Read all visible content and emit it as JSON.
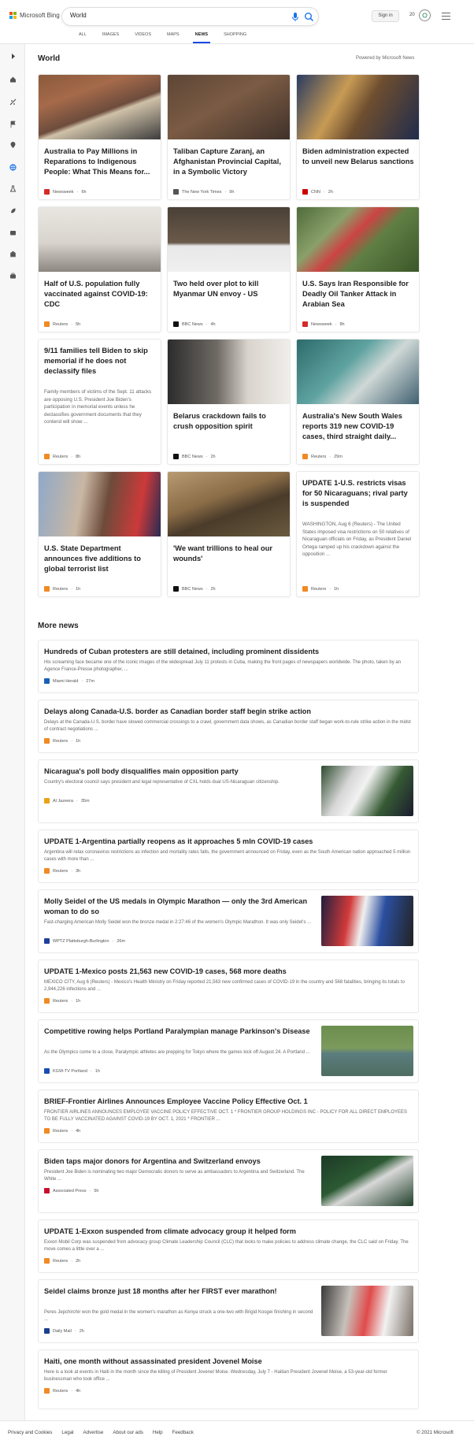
{
  "brand": {
    "name": "Microsoft Bing"
  },
  "search": {
    "query": "World"
  },
  "header": {
    "signin": "Sign in",
    "rewards_count": "20"
  },
  "scopes": [
    "ALL",
    "IMAGES",
    "VIDEOS",
    "MAPS",
    "NEWS",
    "SHOPPING"
  ],
  "active_scope": "NEWS",
  "rail_icons": [
    "expand-icon",
    "home-icon",
    "sports-icon",
    "flag-icon",
    "location-pin-icon",
    "globe-icon",
    "science-icon",
    "rocket-icon",
    "entertainment-icon",
    "politics-icon",
    "business-icon"
  ],
  "section": {
    "title": "World",
    "powered_by": "Powered by Microsoft News"
  },
  "cards": [
    {
      "title": "Australia to Pay Millions in Reparations to Indigenous People: What This Means for...",
      "source": "Newsweek",
      "time": "6h",
      "logo_color": "#d42b2b"
    },
    {
      "title": "Taliban Capture Zaranj, an Afghanistan Provincial Capital, in a Symbolic Victory",
      "source": "The New York Times",
      "time": "9h",
      "logo_color": "#555555"
    },
    {
      "title": "Biden administration expected to unveil new Belarus sanctions",
      "source": "CNN",
      "time": "2h",
      "logo_color": "#cc0000"
    },
    {
      "title": "Half of U.S. population fully vaccinated against COVID-19: CDC",
      "source": "Reuters",
      "time": "5h",
      "logo_color": "#f08a24"
    },
    {
      "title": "Two held over plot to kill Myanmar UN envoy - US",
      "source": "BBC News",
      "time": "4h",
      "logo_color": "#111111"
    },
    {
      "title": "U.S. Says Iran Responsible for Deadly Oil Tanker Attack in Arabian Sea",
      "source": "Newsweek",
      "time": "8h",
      "logo_color": "#d42b2b"
    },
    {
      "title": "9/11 families tell Biden to skip memorial if he does not declassify files",
      "snippet": "Family members of victims of the Sept. 11 attacks are opposing U.S. President Joe Biden's participation in memorial events unless he declassifies government documents that they contend will show ...",
      "source": "Reuters",
      "time": "8h",
      "logo_color": "#f08a24"
    },
    {
      "title": "Belarus crackdown fails to crush opposition spirit",
      "source": "BBC News",
      "time": "2h",
      "logo_color": "#111111"
    },
    {
      "title": "Australia's New South Wales reports 319 new COVID-19 cases, third straight daily...",
      "source": "Reuters",
      "time": "29m",
      "logo_color": "#f08a24"
    },
    {
      "title": "U.S. State Department announces five additions to global terrorist list",
      "source": "Reuters",
      "time": "1h",
      "logo_color": "#f08a24"
    },
    {
      "title": "'We want trillions to heal our wounds'",
      "source": "BBC News",
      "time": "2h",
      "logo_color": "#111111"
    },
    {
      "title": "UPDATE 1-U.S. restricts visas for 50 Nicaraguans; rival party is suspended",
      "snippet": "WASHINGTON, Aug 6 (Reuters) - The United States imposed visa restrictions on 50 relatives of Nicaraguan officials on Friday, as President Daniel Ortega ramped up his crackdown against the opposition ...",
      "source": "Reuters",
      "time": "1h",
      "logo_color": "#f08a24"
    }
  ],
  "more_news": {
    "title": "More news",
    "items": [
      {
        "title": "Hundreds of Cuban protesters are still detained, including prominent dissidents",
        "snippet": "His screaming face became one of the iconic images of the widespread July 11 protests in Cuba, making the front pages of newspapers worldwide. The photo, taken by an Agence France-Presse photographer, ...",
        "source": "Miami Herald",
        "time": "27m",
        "logo_color": "#1a5fb4"
      },
      {
        "title": "Delays along Canada-U.S. border as Canadian border staff begin strike action",
        "snippet": "Delays at the Canada-U.S. border have slowed commercial crossings to a crawl, government data shows, as Canadian border staff began work-to-rule strike action in the midst of contract negotiations ...",
        "source": "Reuters",
        "time": "1h",
        "logo_color": "#f08a24"
      },
      {
        "title": "Nicaragua's poll body disqualifies main opposition party",
        "snippet": "Country's electoral council says president and legal representative of CXL holds dual US-Nicaraguan citizenship.",
        "source": "Al Jazeera",
        "time": "35m",
        "logo_color": "#e8a317"
      },
      {
        "title": "UPDATE 1-Argentina partially reopens as it approaches 5 mln COVID-19 cases",
        "snippet": "Argentina will relax coronavirus restrictions as infection and mortality rates falls, the government announced on Friday, even as the South American nation approached 5 million cases with more than ...",
        "source": "Reuters",
        "time": "3h",
        "logo_color": "#f08a24"
      },
      {
        "title": "Molly Seidel of the US medals in Olympic Marathon — only the 3rd American woman to do so",
        "snippet": "Fast-charging American Molly Seidel won the bronze medal in 2:27:46 of the women's Olympic Marathon. It was only Seidel's ...",
        "source": "WPTZ Plattsburgh-Burlington",
        "time": "26m",
        "logo_color": "#1f3f99"
      },
      {
        "title": "UPDATE 1-Mexico posts 21,563 new COVID-19 cases, 568 more deaths",
        "snippet": "MEXICO CITY, Aug 6 (Reuters) - Mexico's Health Ministry on Friday reported 21,563 new confirmed cases of COVID-19 in the country and 568 fatalities, bringing its totals to 2,944,226 infections and ...",
        "source": "Reuters",
        "time": "1h",
        "logo_color": "#f08a24"
      },
      {
        "title": "Competitive rowing helps Portland Paralympian manage Parkinson's Disease",
        "snippet": "As the Olympics come to a close, Paralympic athletes are prepping for Tokyo where the games kick off August 24. A Portland ...",
        "source": "KGW-TV Portland",
        "time": "1h",
        "logo_color": "#1a4db3"
      },
      {
        "title": "BRIEF-Frontier Airlines Announces Employee Vaccine Policy Effective Oct. 1",
        "snippet": "FRONTIER AIRLINES ANNOUNCES EMPLOYEE VACCINE POLICY EFFECTIVE OCT. 1 * FRONTIER GROUP HOLDINGS INC - POLICY FOR ALL DIRECT EMPLOYEES TO BE FULLY VACCINATED AGAINST COVID-19 BY OCT. 1, 2021 * FRONTIER ...",
        "source": "Reuters",
        "time": "4h",
        "logo_color": "#f08a24"
      },
      {
        "title": "Biden taps major donors for Argentina and Switzerland envoys",
        "snippet": "President Joe Biden is nominating two major Democratic donors to serve as ambassadors to Argentina and Switzerland. The White ...",
        "source": "Associated Press",
        "time": "5h",
        "logo_color": "#c8102e"
      },
      {
        "title": "UPDATE 1-Exxon suspended from climate advocacy group it helped form",
        "snippet": "Exxon Mobil Corp was suspended from advocacy group Climate Leadership Council (CLC) that looks to make policies to address climate change, the CLC said on Friday. The move comes a little over a ...",
        "source": "Reuters",
        "time": "2h",
        "logo_color": "#f08a24"
      },
      {
        "title": "Seidel claims bronze just 18 months after her FIRST ever marathon!",
        "snippet": "Peres Jepchirchir won the gold medal in the women's marathon as Kenya struck a one-two with Brigid Kosgei finishing in second ...",
        "source": "Daily Mail",
        "time": "2h",
        "logo_color": "#1a3f8f"
      },
      {
        "title": "Haiti, one month without assassinated president Jovenel Moise",
        "snippet": "Here is a look at events in Haiti in the month since the killing of President Jovenel Moise. Wednesday, July 7 - Haitian President Jovenel Moise, a 53-year-old former businessman who took office ...",
        "source": "Reuters",
        "time": "4h",
        "logo_color": "#f08a24"
      }
    ]
  },
  "footer": {
    "links": [
      "Privacy and Cookies",
      "Legal",
      "Advertise",
      "About our ads",
      "Help",
      "Feedback"
    ],
    "copyright": "© 2021 Microsoft"
  }
}
